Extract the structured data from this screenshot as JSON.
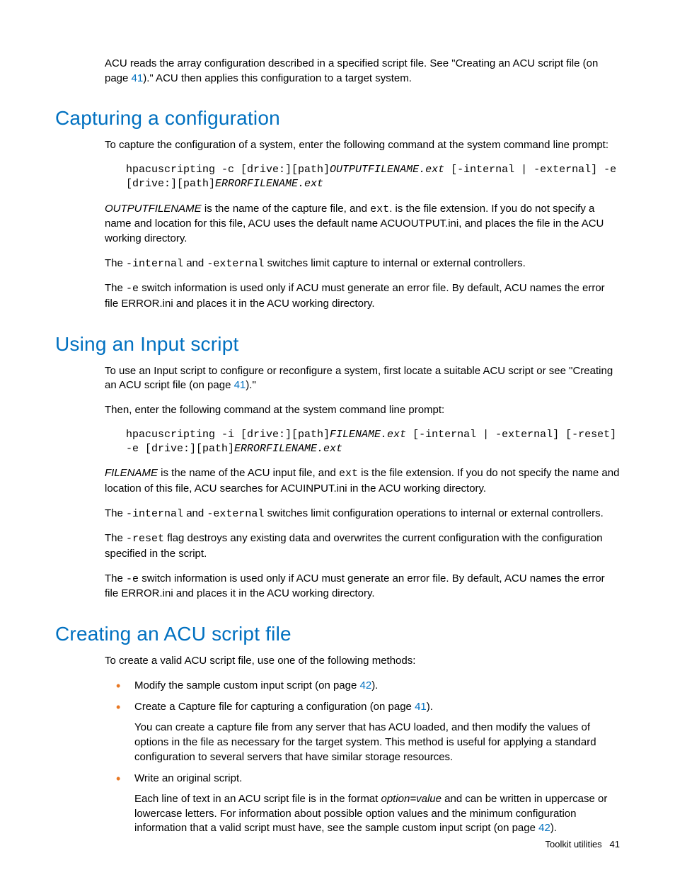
{
  "intro": {
    "p1a": "ACU reads the array configuration described in a specified script file. See \"Creating an ACU script file (on page ",
    "p1link": "41",
    "p1b": ").\" ACU then applies this configuration to a target system."
  },
  "section1": {
    "heading": "Capturing a configuration",
    "p1": "To capture the configuration of a system, enter the following command at the system command line prompt:",
    "code_plain1": "hpacuscripting -c [drive:][path]",
    "code_ital1": "OUTPUTFILENAME.ext",
    "code_plain2": " [-internal | -external] -e [drive:][path]",
    "code_ital2": "ERRORFILENAME.ext",
    "p2a": "OUTPUTFILENAME",
    "p2b": " is the name of the capture file, and ",
    "p2code": "ext",
    "p2c": ". is the file extension. If you do not specify a name and location for this file, ACU uses the default name ACUOUTPUT.ini, and places the file in the ACU working directory.",
    "p3a": "The ",
    "p3code1": "-internal",
    "p3b": " and ",
    "p3code2": "-external",
    "p3c": " switches limit capture to internal or external controllers.",
    "p4a": "The ",
    "p4code": "-e",
    "p4b": " switch information is used only if ACU must generate an error file. By default, ACU names the error file ERROR.ini and places it in the ACU working directory."
  },
  "section2": {
    "heading": "Using an Input script",
    "p1a": "To use an Input script to configure or reconfigure a system, first locate a suitable ACU script or see \"Creating an ACU script file (on page ",
    "p1link": "41",
    "p1b": ").\"",
    "p2": "Then, enter the following command at the system command line prompt:",
    "code_plain1": "hpacuscripting -i [drive:][path]",
    "code_ital1": "FILENAME.ext",
    "code_plain2": " [-internal | -external] [-reset] -e [drive:][path]",
    "code_ital2": "ERRORFILENAME.ext",
    "p3a": "FILENAME",
    "p3b": " is the name of the ACU input file, and ",
    "p3code": "ext",
    "p3c": " is the file extension. If you do not specify the name and location of this file, ACU searches for ACUINPUT.ini in the ACU working directory.",
    "p4a": "The ",
    "p4code1": "-internal",
    "p4b": " and ",
    "p4code2": "-external",
    "p4c": " switches limit configuration operations to internal or external controllers.",
    "p5a": "The ",
    "p5code": "-reset",
    "p5b": " flag destroys any existing data and overwrites the current configuration with the configuration specified in the script.",
    "p6a": "The ",
    "p6code": "-e",
    "p6b": " switch information is used only if ACU must generate an error file. By default, ACU names the error file ERROR.ini and places it in the ACU working directory."
  },
  "section3": {
    "heading": "Creating an ACU script file",
    "p1": "To create a valid ACU script file, use one of the following methods:",
    "li1a": "Modify the sample custom input script (on page ",
    "li1link": "42",
    "li1b": ").",
    "li2a": "Create a Capture file for capturing a configuration (on page ",
    "li2link": "41",
    "li2b": ").",
    "li2sub": "You can create a capture file from any server that has ACU loaded, and then modify the values of options in the file as necessary for the target system. This method is useful for applying a standard configuration to several servers that have similar storage resources.",
    "li3": "Write an original script.",
    "li3sub_a": "Each line of text in an ACU script file is in the format ",
    "li3sub_ital": "option=value",
    "li3sub_b": " and can be written in uppercase or lowercase letters. For information about possible option values and the minimum configuration information that a valid script must have, see the sample custom input script (on page ",
    "li3sub_link": "42",
    "li3sub_c": ")."
  },
  "footer": {
    "label": "Toolkit utilities",
    "page": "41"
  }
}
